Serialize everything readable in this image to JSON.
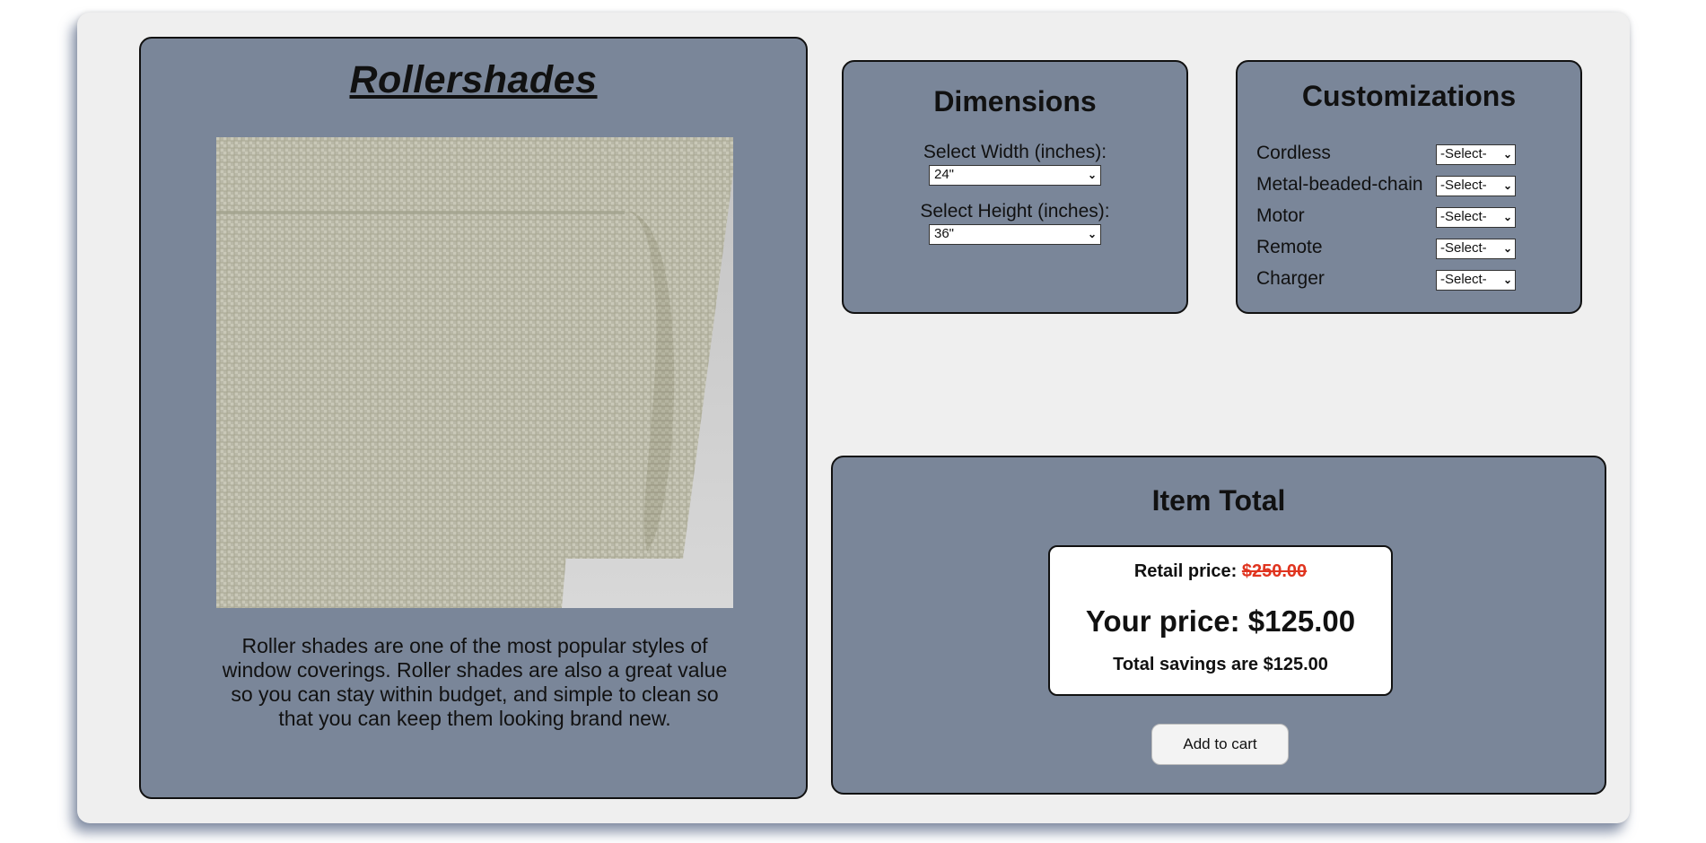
{
  "product": {
    "title": "Rollershades",
    "image_alt": "Roller shade fabric sample",
    "description": "Roller shades are one of the most popular styles of window coverings. Roller shades are also a great value so you can stay within budget, and simple to clean so that you can keep them looking brand new."
  },
  "dimensions": {
    "heading": "Dimensions",
    "width_label": "Select Width (inches):",
    "width_value": "24\"",
    "height_label": "Select Height (inches):",
    "height_value": "36\""
  },
  "customizations": {
    "heading": "Customizations",
    "items": [
      {
        "label": "Cordless",
        "value": "-Select-"
      },
      {
        "label": "Metal-beaded-chain",
        "value": "-Select-"
      },
      {
        "label": "Motor",
        "value": "-Select-"
      },
      {
        "label": "Remote",
        "value": "-Select-"
      },
      {
        "label": "Charger",
        "value": "-Select-"
      }
    ]
  },
  "total": {
    "heading": "Item Total",
    "retail_label": "Retail price:",
    "retail_value": "$250.00",
    "your_price": "Your price: $125.00",
    "savings": "Total savings are $125.00",
    "add_to_cart": "Add to cart"
  },
  "colors": {
    "panel": "#7a8699",
    "background": "#efefef",
    "strike": "#e0341f"
  }
}
